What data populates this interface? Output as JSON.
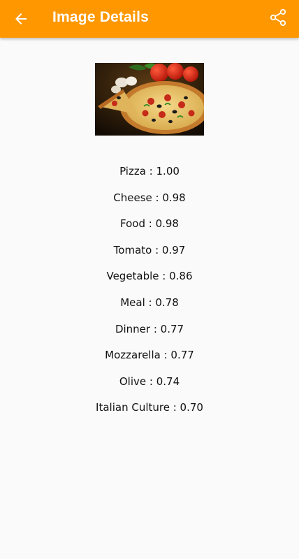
{
  "app_bar": {
    "title": "Image Details",
    "back_icon": "arrow-left-icon",
    "share_icon": "share-icon",
    "color": "#ff9800"
  },
  "image": {
    "subject": "pizza photo"
  },
  "labels": [
    {
      "name": "Pizza",
      "score": "1.00",
      "text": "Pizza : 1.00"
    },
    {
      "name": "Cheese",
      "score": "0.98",
      "text": "Cheese : 0.98"
    },
    {
      "name": "Food",
      "score": "0.98",
      "text": "Food : 0.98"
    },
    {
      "name": "Tomato",
      "score": "0.97",
      "text": "Tomato : 0.97"
    },
    {
      "name": "Vegetable",
      "score": "0.86",
      "text": "Vegetable : 0.86"
    },
    {
      "name": "Meal",
      "score": "0.78",
      "text": "Meal : 0.78"
    },
    {
      "name": "Dinner",
      "score": "0.77",
      "text": "Dinner : 0.77"
    },
    {
      "name": "Mozzarella",
      "score": "0.77",
      "text": "Mozzarella : 0.77"
    },
    {
      "name": "Olive",
      "score": "0.74",
      "text": "Olive : 0.74"
    },
    {
      "name": "Italian Culture",
      "score": "0.70",
      "text": "Italian Culture : 0.70"
    }
  ]
}
